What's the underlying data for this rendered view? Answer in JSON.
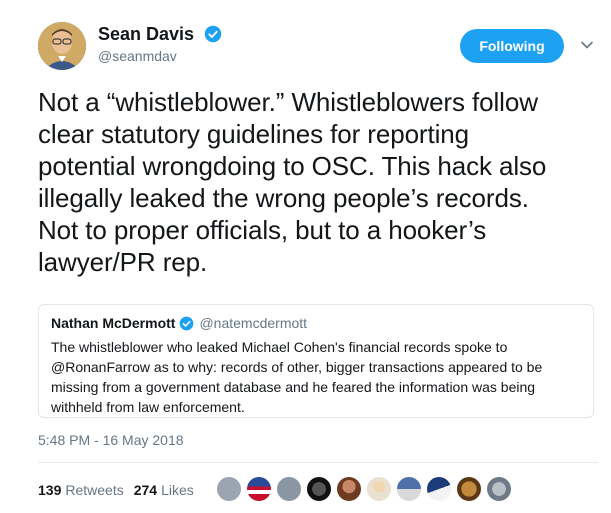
{
  "author": {
    "name": "Sean Davis",
    "handle": "@seanmdav",
    "verified": true
  },
  "follow_button": {
    "label": "Following"
  },
  "tweet": {
    "text": "Not a “whistleblower.” Whistleblowers follow\nclear statutory guidelines for reporting\npotential wrongdoing to OSC. This hack also\nillegally leaked the wrong people’s records.\nNot to proper officials, but to a hooker’s\nlawyer/PR rep."
  },
  "quoted_tweet": {
    "name": "Nathan McDermott",
    "handle": "@natemcdermott",
    "verified": true,
    "text": "The whistleblower who leaked Michael Cohen's financial records spoke to @RonanFarrow as to why: records of other, bigger transactions appeared to be missing from a government database and he feared the information was being withheld from law enforcement."
  },
  "timestamp": "5:48 PM - 16 May 2018",
  "stats": {
    "retweets_count": "139",
    "retweets_label": "Retweets",
    "likes_count": "274",
    "likes_label": "Likes"
  },
  "colors": {
    "accent": "#1da1f2",
    "muted": "#657786",
    "text": "#14171a",
    "border": "#e1e8ed"
  }
}
